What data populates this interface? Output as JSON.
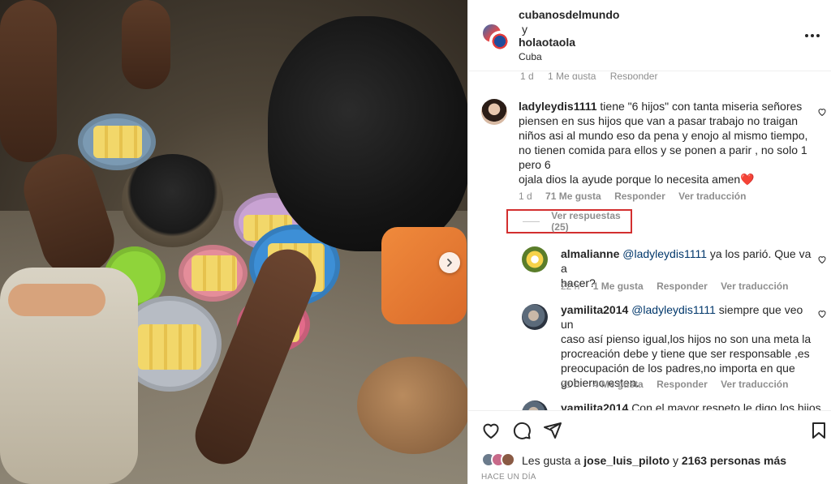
{
  "header": {
    "user1": "cubanosdelmundo",
    "connector": "y",
    "user2": "holaotaola",
    "location": "Cuba"
  },
  "prev_comment_meta": {
    "time": "1 d",
    "likes": "1 Me gusta",
    "reply": "Responder"
  },
  "comments": [
    {
      "username": "ladyleydis1111",
      "lines": [
        "tiene \"6 hijos\" con tanta miseria señores",
        "piensen en sus hijos que van a pasar trabajo no traigan",
        "niños asi al mundo eso da pena y enojo al mismo tiempo,",
        "no tienen comida para ellos y se ponen a parir , no solo 1",
        "pero 6",
        "ojala dios la ayude porque lo necesita amen"
      ],
      "emoji": "❤️",
      "time": "1 d",
      "likes": "71 Me gusta",
      "reply": "Responder",
      "translate": "Ver traducción"
    }
  ],
  "view_replies": "Ver respuestas (25)",
  "replies": [
    {
      "username": "almalianne",
      "mention": "@ladyleydis1111",
      "line1_rest": "ya los parió. Que va a",
      "line2": "hacer?",
      "time": "22 h",
      "likes": "1 Me gusta",
      "reply": "Responder",
      "translate": "Ver traducción"
    },
    {
      "username": "yamilita2014",
      "mention": "@ladyleydis1111",
      "line1_rest": "siempre que veo un",
      "lines": [
        "caso así pienso igual,los hijos no son una meta la",
        "procreación debe y tiene que ser responsable ,es",
        "preocupación de los padres,no importa en que",
        "gobierno esten."
      ],
      "time": "21 h",
      "likes": "4 Me gusta",
      "reply": "Responder",
      "translate": "Ver traducción"
    },
    {
      "username": "yamilita2014",
      "partial_text": "Con el mayor respeto le digo los hijos"
    }
  ],
  "actions": {
    "likes_prefix": "Les gusta a",
    "liker": "jose_luis_piloto",
    "likes_mid": "y",
    "likes_count": "2163 personas más",
    "date": "HACE UN DÍA"
  },
  "icons": [
    "heart-icon",
    "comment-icon",
    "share-icon",
    "bookmark-icon",
    "more-options-icon",
    "next-arrow-icon"
  ],
  "colors": {
    "highlight_box": "#d32f2f",
    "mention": "#00376b",
    "meta_gray": "#8e8e8e"
  }
}
